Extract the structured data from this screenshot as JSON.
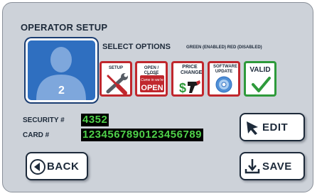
{
  "screen": {
    "title": "OPERATOR SETUP",
    "operator_number": "2",
    "select_options_title": "SELECT OPTIONS",
    "select_options_legend": "GREEN (ENABLED)  RED (DISABLED)"
  },
  "options": [
    {
      "label": "SETUP",
      "state": "disabled",
      "icon": "wrench-screwdriver-icon"
    },
    {
      "label": "OPEN / CLOSE",
      "state": "disabled",
      "icon": "open-sign-icon",
      "sign_small": "Come in we're",
      "sign_big": "OPEN"
    },
    {
      "label": "PRICE CHANGE",
      "state": "disabled",
      "icon": "price-pump-icon",
      "symbol": "$"
    },
    {
      "label": "SOFTWARE UPDATE",
      "state": "disabled",
      "icon": "software-disc-icon"
    },
    {
      "label": "VALID",
      "state": "enabled",
      "icon": "checkmark-icon"
    }
  ],
  "fields": {
    "security_label": "SECURITY #",
    "security_value": "4352",
    "card_label": "CARD #",
    "card_value": "1234567890123456789"
  },
  "buttons": {
    "edit": "EDIT",
    "back": "BACK",
    "save": "SAVE"
  },
  "colors": {
    "enabled": "#2e9a3b",
    "disabled": "#c0272d",
    "value_text": "#4fd14a",
    "avatar": "#2f6fc0"
  }
}
